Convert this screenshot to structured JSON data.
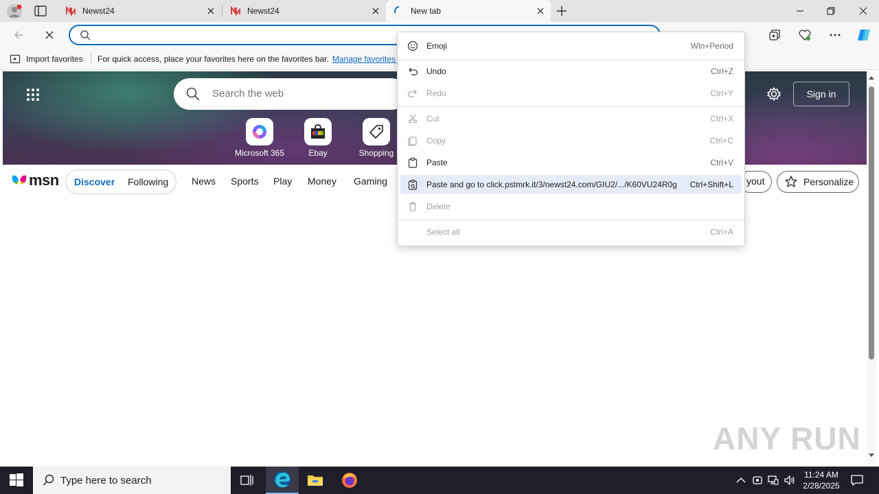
{
  "browser": {
    "tabs": [
      {
        "label": "Newst24"
      },
      {
        "label": "Newst24"
      },
      {
        "label": "New tab"
      }
    ],
    "address": {
      "value": "",
      "placeholder": ""
    }
  },
  "favorites_bar": {
    "import_label": "Import favorites",
    "message": "For quick access, place your favorites here on the favorites bar.",
    "manage_link": "Manage favorites n"
  },
  "newtab": {
    "search_placeholder": "Search the web",
    "quick_links": [
      {
        "label": "Microsoft 365"
      },
      {
        "label": "Ebay"
      },
      {
        "label": "Shopping"
      }
    ],
    "signin_label": "Sign in",
    "msn_logo": "msn",
    "feed_tabs": {
      "discover": "Discover",
      "following": "Following"
    },
    "nav_links": [
      "News",
      "Sports",
      "Play",
      "Money",
      "Gaming"
    ],
    "layout_label": "yout",
    "personalize_label": "Personalize"
  },
  "context_menu": {
    "items": [
      {
        "label": "Emoji",
        "shortcut": "Win+Period",
        "enabled": true
      },
      {
        "label": "Undo",
        "shortcut": "Ctrl+Z",
        "enabled": true
      },
      {
        "label": "Redo",
        "shortcut": "Ctrl+Y",
        "enabled": false
      },
      {
        "label": "Cut",
        "shortcut": "Ctrl+X",
        "enabled": false
      },
      {
        "label": "Copy",
        "shortcut": "Ctrl+C",
        "enabled": false
      },
      {
        "label": "Paste",
        "shortcut": "Ctrl+V",
        "enabled": true
      },
      {
        "label": "Paste and go to click.pstmrk.it/3/newst24.com/GIU2/.../K60VU24R0g",
        "shortcut": "Ctrl+Shift+L",
        "enabled": true,
        "highlighted": true
      },
      {
        "label": "Delete",
        "shortcut": "",
        "enabled": false
      },
      {
        "label": "Select all",
        "shortcut": "Ctrl+A",
        "enabled": false
      }
    ]
  },
  "watermark": "ANY RUN",
  "taskbar": {
    "search_placeholder": "Type here to search",
    "time": "11:24 AM",
    "date": "2/28/2025"
  },
  "colors": {
    "accent": "#0f6cbd",
    "highlight": "#e5ecf7",
    "taskbar": "#1f1f2b"
  }
}
